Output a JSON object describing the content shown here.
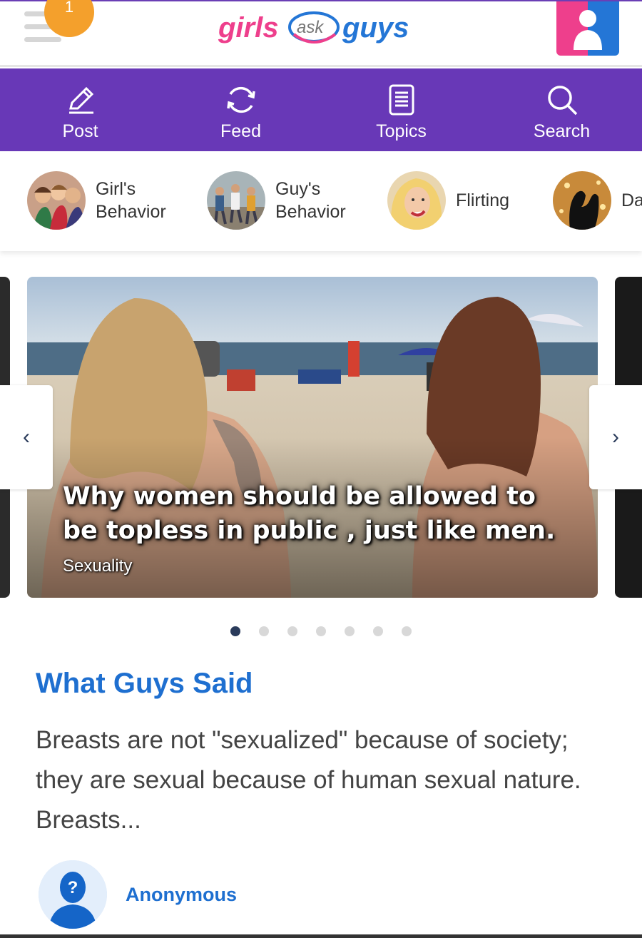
{
  "header": {
    "notification_count": "1",
    "logo": {
      "part1": "girls",
      "part2": "ask",
      "part3": "guys"
    }
  },
  "nav": {
    "items": [
      {
        "label": "Post",
        "icon": "pencil-icon"
      },
      {
        "label": "Feed",
        "icon": "refresh-icon"
      },
      {
        "label": "Topics",
        "icon": "list-icon"
      },
      {
        "label": "Search",
        "icon": "search-icon"
      }
    ]
  },
  "topics": [
    {
      "name": "Girl's\nBehavior"
    },
    {
      "name": "Guy's\nBehavior"
    },
    {
      "name": "Flirting"
    },
    {
      "name": "Da"
    }
  ],
  "carousel": {
    "title": "Why women should be allowed to be topless in public , just like men.",
    "category": "Sexuality",
    "prev_icon": "‹",
    "next_icon": "›",
    "dot_count": 7,
    "active_dot": 0
  },
  "section": {
    "title": "What Guys Said",
    "opinion": "Breasts are not \"sexualized\" because of society; they are sexual because of human sexual nature. Breasts...",
    "author": "Anonymous"
  },
  "colors": {
    "nav_bg": "#6838b7",
    "link_blue": "#1e6fd0",
    "badge_orange": "#f4a02c",
    "brand_pink": "#ee3f8c",
    "brand_blue": "#2476d6"
  }
}
